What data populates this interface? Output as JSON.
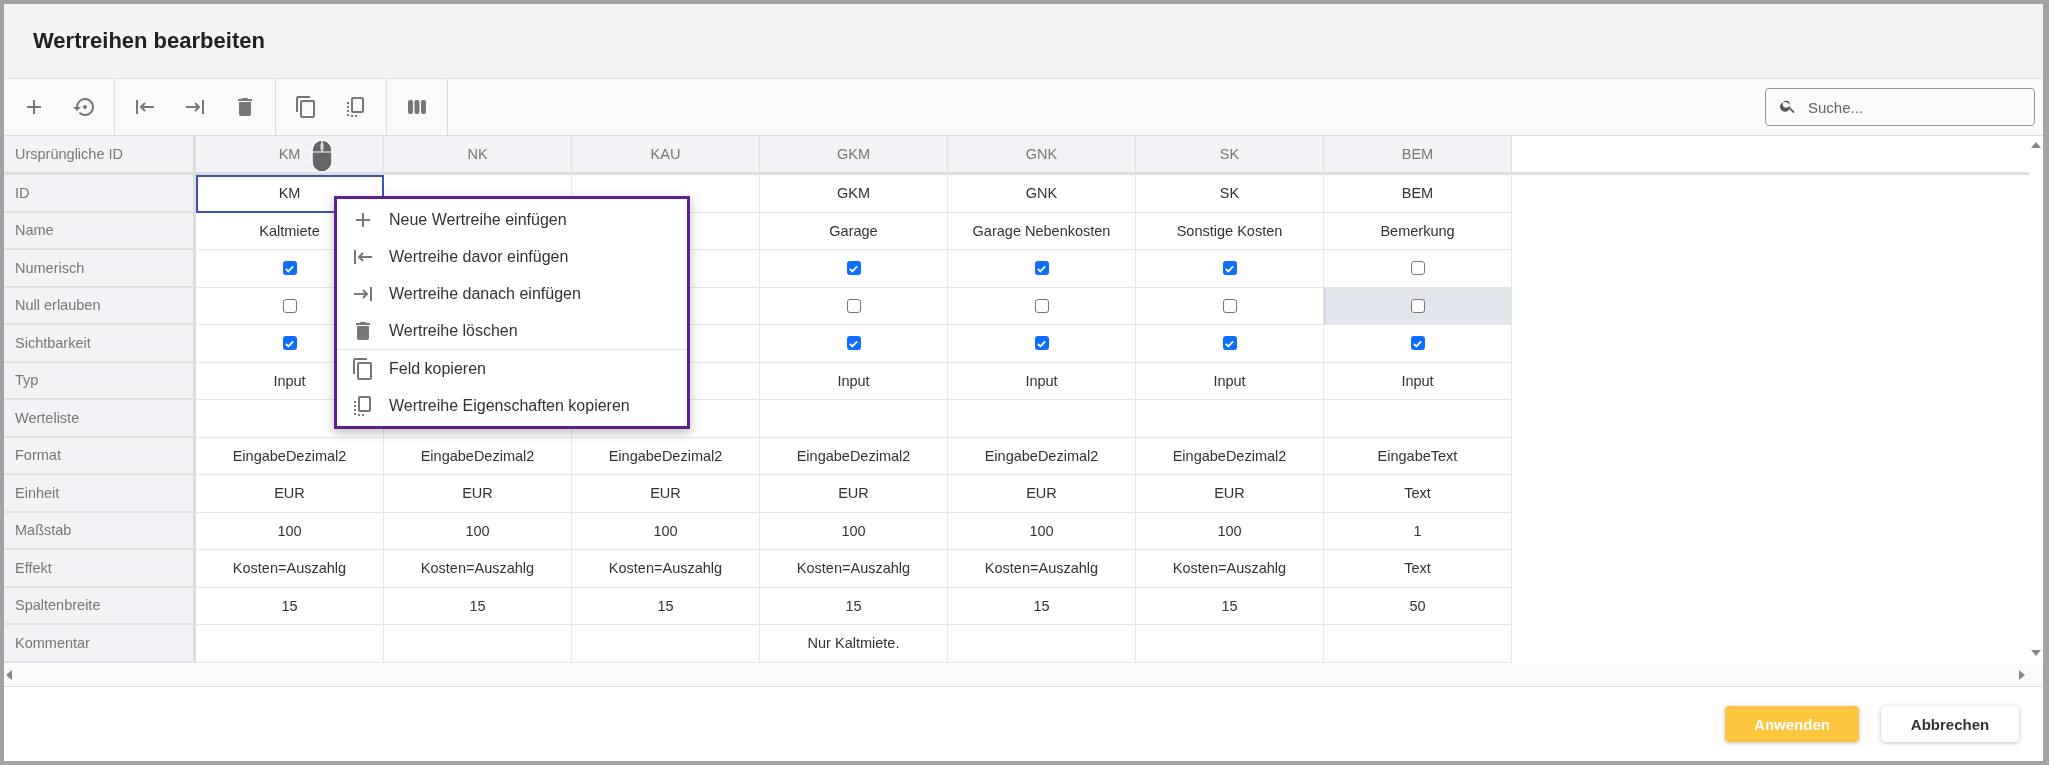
{
  "window": {
    "title": "Wertreihen bearbeiten"
  },
  "search": {
    "placeholder": "Suche..."
  },
  "table": {
    "corner": "Ursprüngliche ID",
    "columns": [
      "KM",
      "NK",
      "KAU",
      "GKM",
      "GNK",
      "SK",
      "BEM"
    ],
    "rows": [
      {
        "label": "ID",
        "kind": "text",
        "cells": [
          {
            "text": "KM",
            "selected": true,
            "hovered": false
          },
          null,
          null,
          {
            "text": "GKM",
            "selected": false,
            "hovered": false
          },
          {
            "text": "GNK",
            "selected": false,
            "hovered": false
          },
          {
            "text": "SK",
            "selected": false,
            "hovered": false
          },
          {
            "text": "BEM",
            "selected": false,
            "hovered": false
          }
        ]
      },
      {
        "label": "Name",
        "kind": "text",
        "cells": [
          {
            "text": "Kaltmiete",
            "selected": false,
            "hovered": false
          },
          null,
          null,
          {
            "text": "Garage",
            "selected": false,
            "hovered": false
          },
          {
            "text": "Garage Nebenkosten",
            "selected": false,
            "hovered": false
          },
          {
            "text": "Sonstige Kosten",
            "selected": false,
            "hovered": false
          },
          {
            "text": "Bemerkung",
            "selected": false,
            "hovered": false
          }
        ]
      },
      {
        "label": "Numerisch",
        "kind": "checkbox",
        "cells": [
          {
            "checked": true,
            "selected": false,
            "hovered": false
          },
          null,
          null,
          {
            "checked": true,
            "selected": false,
            "hovered": false
          },
          {
            "checked": true,
            "selected": false,
            "hovered": false
          },
          {
            "checked": true,
            "selected": false,
            "hovered": false
          },
          {
            "checked": false,
            "selected": false,
            "hovered": false
          }
        ]
      },
      {
        "label": "Null erlauben",
        "kind": "checkbox",
        "cells": [
          {
            "checked": false,
            "selected": false,
            "hovered": false
          },
          null,
          null,
          {
            "checked": false,
            "selected": false,
            "hovered": false
          },
          {
            "checked": false,
            "selected": false,
            "hovered": false
          },
          {
            "checked": false,
            "selected": false,
            "hovered": false
          },
          {
            "checked": false,
            "selected": false,
            "hovered": true
          }
        ]
      },
      {
        "label": "Sichtbarkeit",
        "kind": "checkbox",
        "cells": [
          {
            "checked": true,
            "selected": false,
            "hovered": false
          },
          null,
          null,
          {
            "checked": true,
            "selected": false,
            "hovered": false
          },
          {
            "checked": true,
            "selected": false,
            "hovered": false
          },
          {
            "checked": true,
            "selected": false,
            "hovered": false
          },
          {
            "checked": true,
            "selected": false,
            "hovered": false
          }
        ]
      },
      {
        "label": "Typ",
        "kind": "text",
        "cells": [
          {
            "text": "Input",
            "selected": false,
            "hovered": false
          },
          null,
          null,
          {
            "text": "Input",
            "selected": false,
            "hovered": false
          },
          {
            "text": "Input",
            "selected": false,
            "hovered": false
          },
          {
            "text": "Input",
            "selected": false,
            "hovered": false
          },
          {
            "text": "Input",
            "selected": false,
            "hovered": false
          }
        ]
      },
      {
        "label": "Werteliste",
        "kind": "text",
        "cells": [
          {
            "selected": false,
            "hovered": false
          },
          {
            "selected": false,
            "hovered": false
          },
          {
            "selected": false,
            "hovered": false
          },
          {
            "selected": false,
            "hovered": false
          },
          {
            "selected": false,
            "hovered": false
          },
          {
            "selected": false,
            "hovered": false
          },
          {
            "selected": false,
            "hovered": false
          }
        ]
      },
      {
        "label": "Format",
        "kind": "text",
        "cells": [
          {
            "text": "EingabeDezimal2",
            "selected": false,
            "hovered": false
          },
          {
            "text": "EingabeDezimal2",
            "selected": false,
            "hovered": false
          },
          {
            "text": "EingabeDezimal2",
            "selected": false,
            "hovered": false
          },
          {
            "text": "EingabeDezimal2",
            "selected": false,
            "hovered": false
          },
          {
            "text": "EingabeDezimal2",
            "selected": false,
            "hovered": false
          },
          {
            "text": "EingabeDezimal2",
            "selected": false,
            "hovered": false
          },
          {
            "text": "EingabeText",
            "selected": false,
            "hovered": false
          }
        ]
      },
      {
        "label": "Einheit",
        "kind": "text",
        "cells": [
          {
            "text": "EUR",
            "selected": false,
            "hovered": false
          },
          {
            "text": "EUR",
            "selected": false,
            "hovered": false
          },
          {
            "text": "EUR",
            "selected": false,
            "hovered": false
          },
          {
            "text": "EUR",
            "selected": false,
            "hovered": false
          },
          {
            "text": "EUR",
            "selected": false,
            "hovered": false
          },
          {
            "text": "EUR",
            "selected": false,
            "hovered": false
          },
          {
            "text": "Text",
            "selected": false,
            "hovered": false
          }
        ]
      },
      {
        "label": "Maßstab",
        "kind": "text",
        "cells": [
          {
            "text": "100",
            "selected": false,
            "hovered": false
          },
          {
            "text": "100",
            "selected": false,
            "hovered": false
          },
          {
            "text": "100",
            "selected": false,
            "hovered": false
          },
          {
            "text": "100",
            "selected": false,
            "hovered": false
          },
          {
            "text": "100",
            "selected": false,
            "hovered": false
          },
          {
            "text": "100",
            "selected": false,
            "hovered": false
          },
          {
            "text": "1",
            "selected": false,
            "hovered": false
          }
        ]
      },
      {
        "label": "Effekt",
        "kind": "text",
        "cells": [
          {
            "text": "Kosten=Auszahlg",
            "selected": false,
            "hovered": false
          },
          {
            "text": "Kosten=Auszahlg",
            "selected": false,
            "hovered": false
          },
          {
            "text": "Kosten=Auszahlg",
            "selected": false,
            "hovered": false
          },
          {
            "text": "Kosten=Auszahlg",
            "selected": false,
            "hovered": false
          },
          {
            "text": "Kosten=Auszahlg",
            "selected": false,
            "hovered": false
          },
          {
            "text": "Kosten=Auszahlg",
            "selected": false,
            "hovered": false
          },
          {
            "text": "Text",
            "selected": false,
            "hovered": false
          }
        ]
      },
      {
        "label": "Spaltenbreite",
        "kind": "text",
        "cells": [
          {
            "text": "15",
            "selected": false,
            "hovered": false
          },
          {
            "text": "15",
            "selected": false,
            "hovered": false
          },
          {
            "text": "15",
            "selected": false,
            "hovered": false
          },
          {
            "text": "15",
            "selected": false,
            "hovered": false
          },
          {
            "text": "15",
            "selected": false,
            "hovered": false
          },
          {
            "text": "15",
            "selected": false,
            "hovered": false
          },
          {
            "text": "50",
            "selected": false,
            "hovered": false
          }
        ]
      },
      {
        "label": "Kommentar",
        "kind": "text",
        "cells": [
          {
            "selected": false,
            "hovered": false
          },
          {
            "selected": false,
            "hovered": false
          },
          {
            "selected": false,
            "hovered": false
          },
          {
            "text": "Nur Kaltmiete.",
            "selected": false,
            "hovered": false
          },
          {
            "selected": false,
            "hovered": false
          },
          {
            "selected": false,
            "hovered": false
          },
          {
            "selected": false,
            "hovered": false
          }
        ]
      }
    ]
  },
  "context_menu": {
    "groups": [
      [
        "Neue Wertreihe einfügen",
        "Wertreihe davor einfügen",
        "Wertreihe danach einfügen",
        "Wertreihe löschen"
      ],
      [
        "Feld kopieren",
        "Wertreihe Eigenschaften kopieren"
      ]
    ]
  },
  "buttons": [
    {
      "label": "Anwenden",
      "kind": "primary"
    },
    {
      "label": "Abbrechen",
      "kind": "secondary"
    }
  ]
}
